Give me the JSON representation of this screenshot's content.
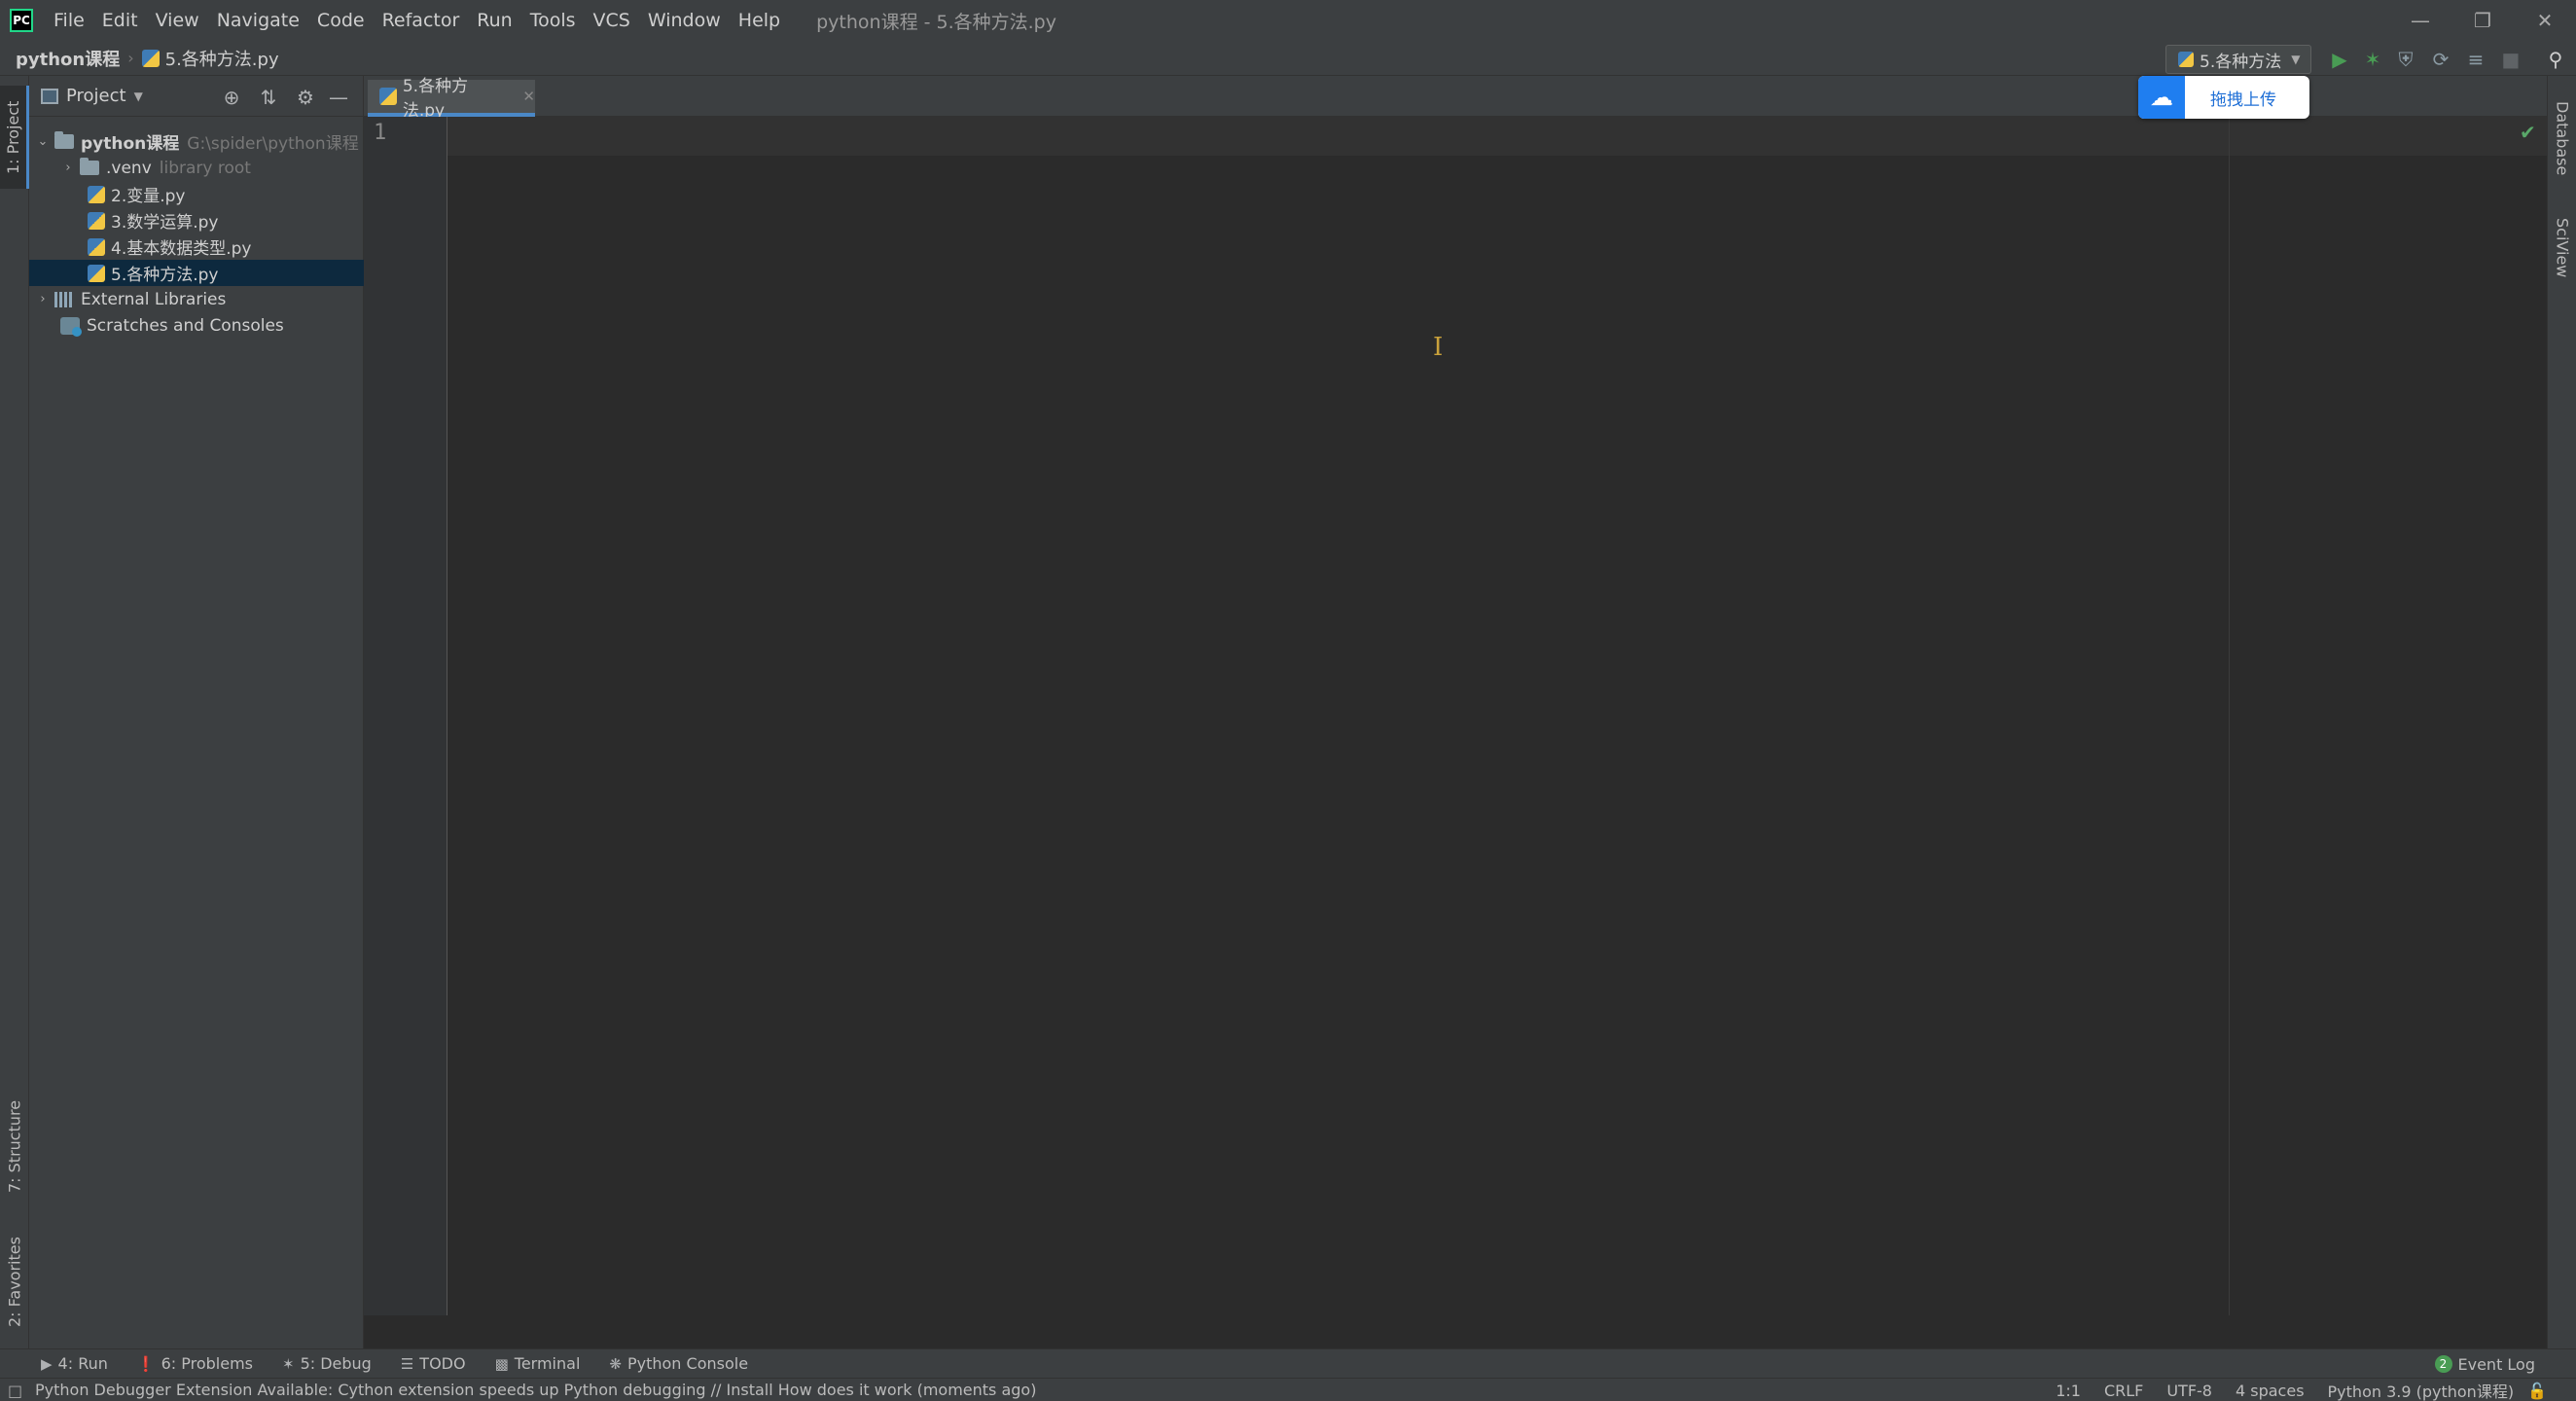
{
  "app": {
    "logo_text": "PC",
    "window_title": "python课程 - 5.各种方法.py"
  },
  "menu": [
    "File",
    "Edit",
    "View",
    "Navigate",
    "Code",
    "Refactor",
    "Run",
    "Tools",
    "VCS",
    "Window",
    "Help"
  ],
  "navbar": {
    "project": "python课程",
    "file": "5.各种方法.py",
    "run_config": "5.各种方法"
  },
  "upload_widget": {
    "label": "拖拽上传"
  },
  "left_strip": {
    "project_tab": "1: Project",
    "structure_tab": "7: Structure",
    "favorites_tab": "2: Favorites"
  },
  "right_strip": {
    "database_tab": "Database",
    "sciview_tab": "SciView"
  },
  "project_panel": {
    "title": "Project",
    "tree": [
      {
        "label": "python课程",
        "hint": "G:\\spider\\python课程"
      },
      {
        "label": ".venv",
        "hint": "library root"
      },
      {
        "label": "2.变量.py"
      },
      {
        "label": "3.数学运算.py"
      },
      {
        "label": "4.基本数据类型.py"
      },
      {
        "label": "5.各种方法.py"
      },
      {
        "label": "External Libraries"
      },
      {
        "label": "Scratches and Consoles"
      }
    ]
  },
  "editor": {
    "tab_label": "5.各种方法.py",
    "line_number": "1"
  },
  "bottom_tools": {
    "run": "4: Run",
    "problems": "6: Problems",
    "debug": "5: Debug",
    "todo": "TODO",
    "terminal": "Terminal",
    "python_console": "Python Console",
    "event_log": "Event Log",
    "event_count": "2"
  },
  "statusbar": {
    "message": "Python Debugger Extension Available: Cython extension speeds up Python debugging // Install   How does it work (moments ago)",
    "position": "1:1",
    "line_sep": "CRLF",
    "encoding": "UTF-8",
    "indent": "4 spaces",
    "interpreter": "Python 3.9 (python课程)"
  },
  "colors": {
    "accent": "#4a88c7",
    "selection": "#0d293e",
    "editor_bg": "#2b2b2b",
    "panel_bg": "#3c3f41"
  }
}
